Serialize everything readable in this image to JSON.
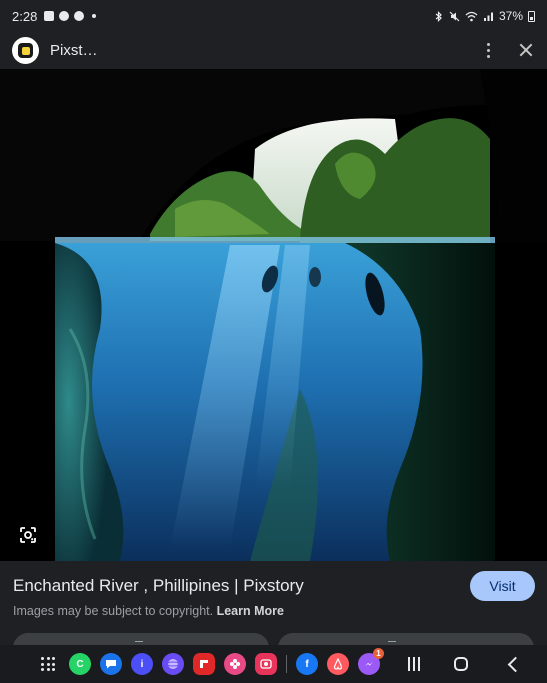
{
  "status_bar": {
    "time": "2:28",
    "battery": "37%"
  },
  "header": {
    "site_name": "Pixst…",
    "menu_icon": "more-vert-icon",
    "close_icon": "close-icon"
  },
  "image": {
    "description_icon": "google-lens-icon"
  },
  "result": {
    "title": "Enchanted River , Phillipines | Pixstory",
    "visit_label": "Visit",
    "copyright_text": "Images may be subject to copyright.",
    "learn_more_label": "Learn More"
  },
  "dock": {
    "apps": [
      {
        "name": "apps-grid-icon"
      },
      {
        "name": "whatsapp-business-icon",
        "letter": "C",
        "color": "#25d366"
      },
      {
        "name": "messages-icon",
        "color": "#1a73e8"
      },
      {
        "name": "chat-icon",
        "letter": "i",
        "color": "#4b4ff5"
      },
      {
        "name": "internet-browser-icon",
        "color": "#6a4cf5"
      },
      {
        "name": "flipboard-icon",
        "color": "#e12828"
      },
      {
        "name": "gallery-icon",
        "color": "#e94a86"
      },
      {
        "name": "screen-recorder-icon",
        "color": "#e8345a"
      },
      {
        "name": "facebook-icon",
        "letter": "f",
        "color": "#1877f2"
      },
      {
        "name": "airbnb-icon",
        "color": "#ff5a5f"
      },
      {
        "name": "messenger-icon",
        "color": "#9b59f6",
        "badge": "1"
      }
    ],
    "recents_icon": "recents-icon",
    "home_icon": "home-icon",
    "back_icon": "back-icon"
  },
  "colors": {
    "background": "#1f2023",
    "visit_button": "#a8c7fa",
    "water": "#1e6fb0",
    "foliage": "#3f7a2e"
  }
}
